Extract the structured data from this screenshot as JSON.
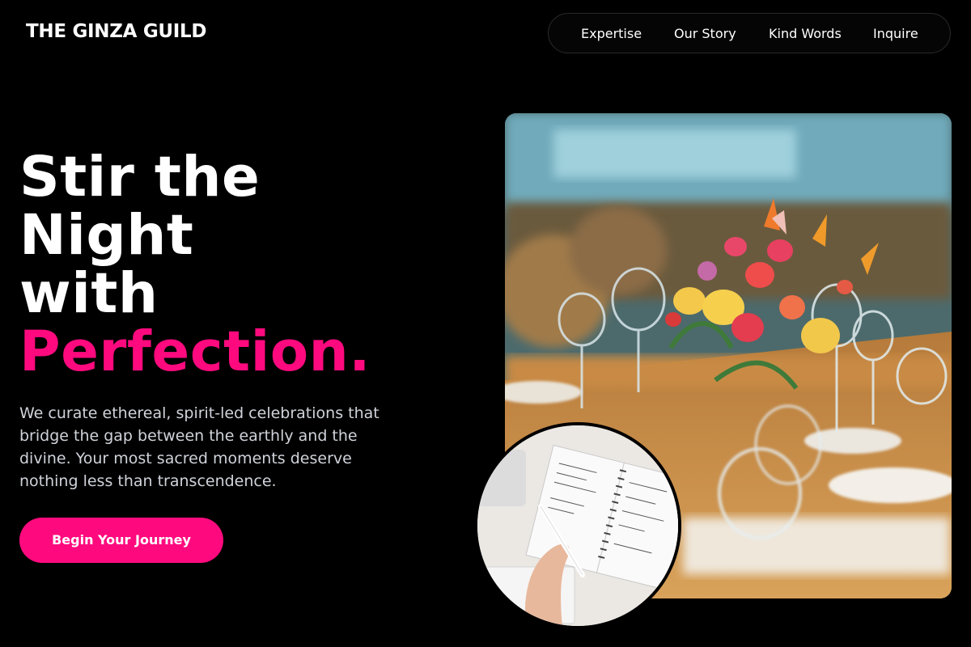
{
  "brand": {
    "name": "THE GINZA GUILD"
  },
  "nav": {
    "items": [
      {
        "label": "Expertise"
      },
      {
        "label": "Our Story"
      },
      {
        "label": "Kind Words"
      },
      {
        "label": "Inquire"
      }
    ]
  },
  "hero": {
    "headline_lines": [
      "Stir the",
      "Night",
      "with"
    ],
    "headline_accent": "Perfection.",
    "subtext": "We curate ethereal, spirit-led celebrations that bridge the gap between the earthly and the divine. Your most sacred moments deserve nothing less than transcendence.",
    "cta_label": "Begin Your Journey"
  },
  "colors": {
    "background": "#000000",
    "accent": "#ff0a7e",
    "body_text": "#cfd3da"
  },
  "images": {
    "main": "banquet-table-flowers-photo",
    "inset": "planner-notebook-writing-photo"
  }
}
